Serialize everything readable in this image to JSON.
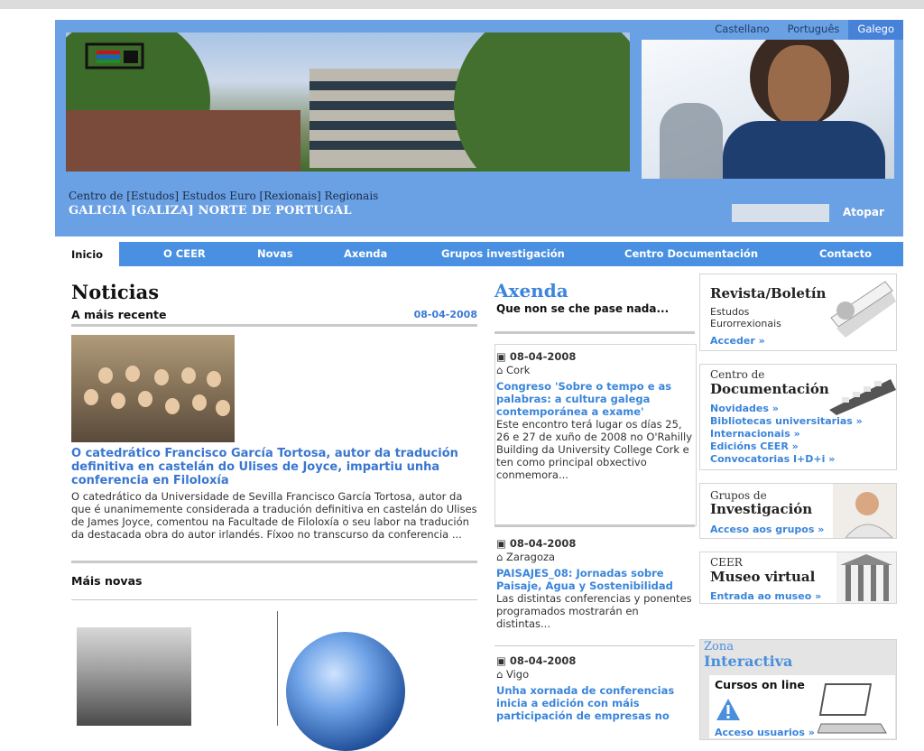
{
  "header": {
    "languages": [
      "Castellano",
      "Português",
      "Galego"
    ],
    "org_line1": "Centro de [Estudos] Estudos Euro [Rexionais] Regionais",
    "org_line2": "GALICIA [GALIZA] NORTE DE PORTUGAL",
    "search_button": "Atopar"
  },
  "nav": [
    "Inicio",
    "O CEER",
    "Novas",
    "Axenda",
    "Grupos investigación",
    "Centro Documentación",
    "Contacto"
  ],
  "news": {
    "title": "Noticias",
    "subtitle": "A máis recente",
    "date": "08-04-2008",
    "headline": "O catedrático Francisco García Tortosa, autor da tradución definitiva en castelán do Ulises de Joyce, impartiu unha conferencia en Filoloxía",
    "body": "O catedrático da Universidade de Sevilla Francisco García Tortosa, autor da que é unanimemente considerada a tradución definitiva en castelán do Ulises de James Joyce, comentou na Facultade de Filoloxía o seu labor na tradución da destacada obra do autor irlandés. Fíxoo no transcurso da conferencia ...",
    "more_heading": "Máis novas"
  },
  "agenda": {
    "title": "Axenda",
    "subtitle": "Que non se che pase nada...",
    "events": [
      {
        "date": "08-04-2008",
        "place": "Cork",
        "title": "Congreso 'Sobre o tempo e as palabras: a cultura galega contemporánea a exame'",
        "desc": "Este encontro terá lugar os días 25, 26 e 27 de xuño de 2008 no O'Rahilly Building da University College Cork e ten como principal obxectivo conmemora..."
      },
      {
        "date": "08-04-2008",
        "place": "Zaragoza",
        "title": "PAISAJES_08: Jornadas sobre Paisaje, Agua y Sostenibilidad",
        "desc": "Las distintas conferencias y ponentes programados mostrarán en distintas..."
      },
      {
        "date": "08-04-2008",
        "place": "Vigo",
        "title": "Unha xornada de conferencias inicia a edición con máis participación de empresas no",
        "desc": ""
      }
    ]
  },
  "sidebar": {
    "revista": {
      "title": "Revista/Boletín",
      "sub": "Estudos Eurorrexionais",
      "link": "Acceder »"
    },
    "documentacion": {
      "small": "Centro de",
      "title": "Documentación",
      "links": [
        "Novidades »",
        "Bibliotecas universitarias »",
        "Internacionais »",
        "Edicións CEER »",
        "Convocatorias I+D+i »"
      ]
    },
    "grupos": {
      "small": "Grupos de",
      "title": "Investigación",
      "link": "Acceso aos grupos »"
    },
    "museo": {
      "small": "CEER",
      "title": "Museo virtual",
      "link": "Entrada ao museo »"
    },
    "zona": {
      "small": "Zona",
      "title": "Interactiva",
      "cursos": "Cursos on line",
      "link": "Acceso usuarios »"
    }
  },
  "colors": {
    "header_blue": "#6aa0e4",
    "nav_blue": "#4a90e2",
    "link_blue": "#3a85da"
  }
}
